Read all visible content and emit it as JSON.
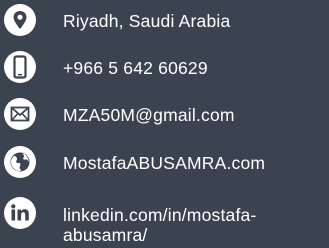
{
  "contact": {
    "items": [
      {
        "icon": "location-pin-icon",
        "text": "Riyadh, Saudi Arabia"
      },
      {
        "icon": "mobile-phone-icon",
        "text": "+966 5 642 60629"
      },
      {
        "icon": "envelope-icon",
        "text": "MZA50M@gmail.com"
      },
      {
        "icon": "globe-icon",
        "text": "MostafaABUSAMRA.com"
      },
      {
        "icon": "linkedin-icon",
        "text": "linkedin.com/in/mostafa-abusamra/"
      }
    ]
  },
  "colors": {
    "background": "#3b4351",
    "text": "#ffffff",
    "icon_bg": "#ffffff",
    "icon_fg": "#3b4351"
  }
}
